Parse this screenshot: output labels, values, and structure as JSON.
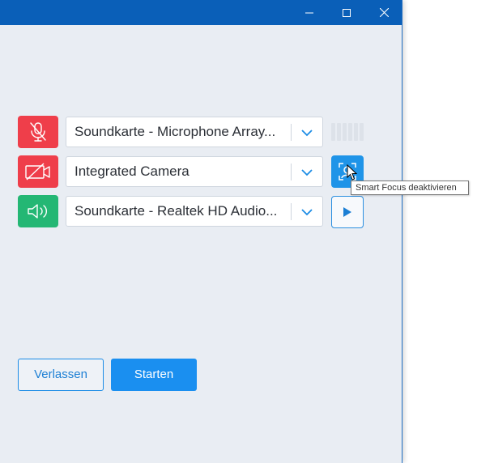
{
  "window": {
    "controls": [
      "minimize-icon",
      "maximize-icon",
      "close-icon"
    ]
  },
  "rows": [
    {
      "icon": "microphone-muted-icon",
      "value": "Soundkarte - Microphone Array...",
      "action": "audio-level-meter"
    },
    {
      "icon": "camera-off-icon",
      "value": "Integrated Camera",
      "action": "smart-focus-icon"
    },
    {
      "icon": "speaker-icon",
      "value": "Soundkarte - Realtek HD Audio...",
      "action": "play-icon"
    }
  ],
  "tooltip": {
    "text": "Smart Focus deaktivieren"
  },
  "buttons": {
    "leave": "Verlassen",
    "start": "Starten"
  },
  "colors": {
    "titlebar": "#0a5fb8",
    "muted": "#ef3e4a",
    "active": "#24b774",
    "accent": "#1a8ff0"
  }
}
